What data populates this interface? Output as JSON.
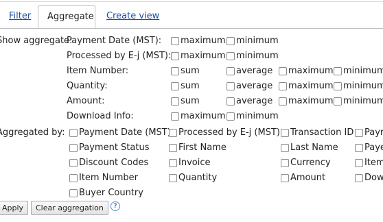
{
  "tabs": {
    "filter": "Filter",
    "aggregate": "Aggregate",
    "create_view": "Create view"
  },
  "show_aggregate": {
    "label": "Show aggregate:",
    "rows": [
      {
        "label": "Payment Date (MST):",
        "options": [
          "maximum",
          "minimum"
        ]
      },
      {
        "label": "Processed by E-j (MST):",
        "options": [
          "maximum",
          "minimum"
        ]
      },
      {
        "label": "Item Number:",
        "options": [
          "sum",
          "average",
          "maximum",
          "minimum"
        ]
      },
      {
        "label": "Quantity:",
        "options": [
          "sum",
          "average",
          "maximum",
          "minimum"
        ]
      },
      {
        "label": "Amount:",
        "options": [
          "sum",
          "average",
          "maximum",
          "minimum"
        ]
      },
      {
        "label": "Download Info:",
        "options": [
          "maximum",
          "minimum"
        ]
      }
    ]
  },
  "aggregated_by": {
    "label": "Aggregated by:",
    "rows": [
      [
        "Payment Date (MST)",
        "Processed by E-j (MST)",
        "Transaction ID",
        "Payr"
      ],
      [
        "Payment Status",
        "First Name",
        "Last Name",
        "Paye"
      ],
      [
        "Discount Codes",
        "Invoice",
        "Currency",
        "Item"
      ],
      [
        "Item Number",
        "Quantity",
        "Amount",
        "Dow"
      ],
      [
        "Buyer Country"
      ]
    ]
  },
  "buttons": {
    "apply": "Apply",
    "clear": "Clear aggregation",
    "help": "?"
  }
}
